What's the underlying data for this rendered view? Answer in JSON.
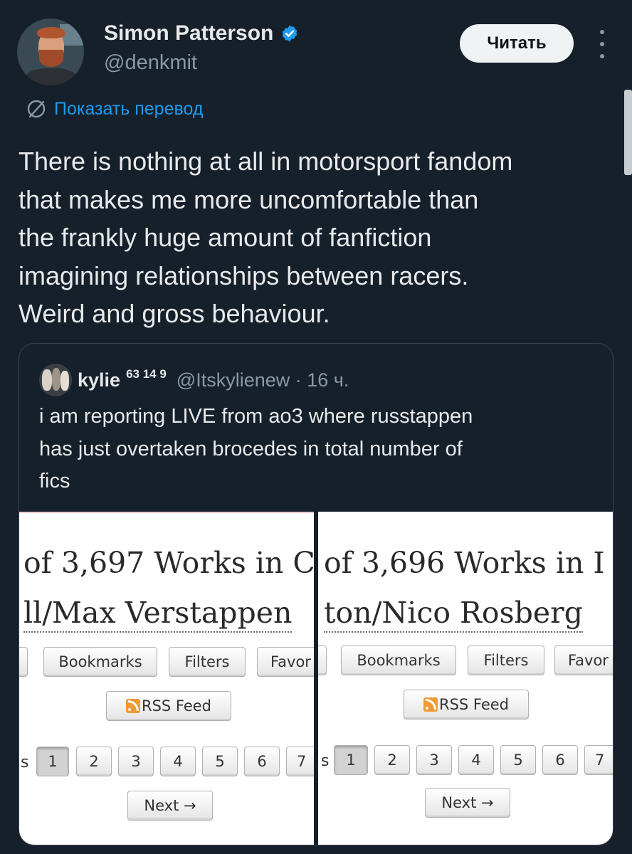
{
  "author": {
    "display_name": "Simon Patterson",
    "handle": "@denkmit",
    "verified": true,
    "follow_label": "Читать"
  },
  "translate_label": "Показать перевод",
  "tweet_lines": [
    "There is nothing at all in motorsport fandom",
    "that makes me more uncomfortable than",
    "the frankly huge amount of fanfiction",
    "imagining relationships between racers.",
    "Weird and gross behaviour."
  ],
  "quote": {
    "name": "kylie",
    "name_suffix": "63 14 9",
    "handle_time": "@Itskylienew · 16 ч.",
    "text_lines": [
      "i am reporting LIVE from ao3 where russtappen",
      "has just overtaken brocedes in total number of",
      "fics"
    ]
  },
  "images": {
    "left": {
      "heading1": "of 3,697 Works in C",
      "heading2": "ll/Max Verstappen",
      "buttons": [
        "Bookmarks",
        "Filters",
        "Favor"
      ],
      "rss_label": "RSS Feed",
      "pages": [
        "1",
        "2",
        "3",
        "4",
        "5",
        "6",
        "7"
      ],
      "pages_prefix": "s",
      "selected_page": "1",
      "next_label": "Next →"
    },
    "right": {
      "heading1": "of 3,696 Works in I",
      "heading2": "ton/Nico Rosberg",
      "buttons": [
        "Bookmarks",
        "Filters",
        "Favor"
      ],
      "rss_label": "RSS Feed",
      "pages": [
        "1",
        "2",
        "3",
        "4",
        "5",
        "6",
        "7"
      ],
      "pages_prefix": "s",
      "selected_page": "1",
      "next_label": "Next →"
    }
  },
  "colors": {
    "background": "#15202b",
    "accent": "#1d9bf0",
    "secondary_text": "#8b98a5"
  }
}
